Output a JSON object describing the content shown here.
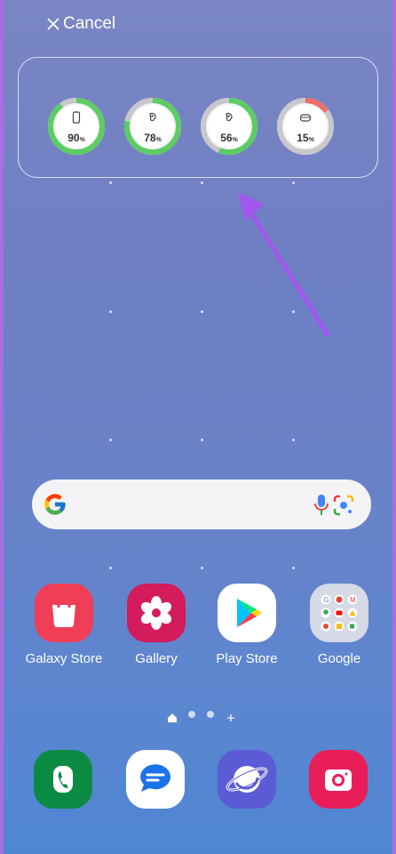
{
  "header": {
    "cancel_label": "Cancel"
  },
  "battery_widget": [
    {
      "device": "phone",
      "percent": "90",
      "unit": "%",
      "level": 0.9,
      "color": "#5ccd63"
    },
    {
      "device": "earbud",
      "percent": "78",
      "unit": "%",
      "level": 0.78,
      "color": "#5ccd63"
    },
    {
      "device": "earbud",
      "percent": "56",
      "unit": "%",
      "level": 0.56,
      "color": "#5ccd63"
    },
    {
      "device": "case",
      "percent": "15",
      "unit": "%",
      "level": 0.15,
      "color": "#f06c6c"
    }
  ],
  "search_bar": {
    "google_icon": "google-g-icon",
    "mic_icon": "mic-icon",
    "lens_icon": "lens-icon"
  },
  "apps": [
    {
      "label": "Galaxy Store",
      "icon": "galaxy-store-icon"
    },
    {
      "label": "Gallery",
      "icon": "gallery-icon"
    },
    {
      "label": "Play Store",
      "icon": "play-store-icon"
    },
    {
      "label": "Google",
      "icon": "google-folder-icon"
    }
  ],
  "dock": [
    {
      "icon": "phone-icon"
    },
    {
      "icon": "messages-icon"
    },
    {
      "icon": "internet-icon"
    },
    {
      "icon": "camera-icon"
    }
  ],
  "colors": {
    "accent_arrow": "#a257ec"
  }
}
